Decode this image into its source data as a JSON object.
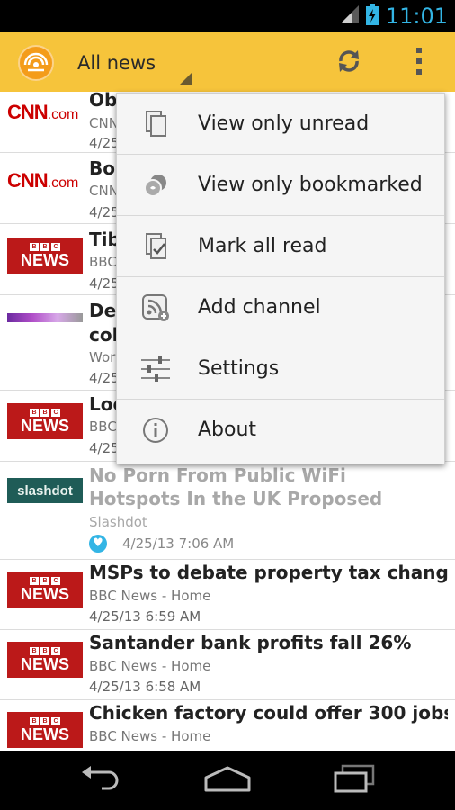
{
  "status_bar": {
    "time": "11:01",
    "icons": [
      "signal-icon",
      "battery-charging-icon"
    ]
  },
  "action_bar": {
    "logo_icon": "rss-logo-icon",
    "title": "All news",
    "refresh_icon": "refresh-icon",
    "overflow_icon": "overflow-menu-icon"
  },
  "news": [
    {
      "title": "Ob",
      "source": "CNN",
      "date": "4/25",
      "logo": "CNN",
      "read": false
    },
    {
      "title": "Bor",
      "source": "CNN",
      "date": "4/25",
      "logo": "CNN",
      "read": false
    },
    {
      "title": "Tib",
      "source": "BBC",
      "date": "4/25",
      "logo": "BBC",
      "read": false
    },
    {
      "title": "Dea",
      "title2": "col",
      "source": "Wor",
      "date": "4/25",
      "logo": "World Crunch",
      "read": false
    },
    {
      "title": "Loc",
      "source": "BBC",
      "date": "4/25",
      "logo": "BBC",
      "read": false
    },
    {
      "title": "No Porn From Public WiFi Hotspots In the UK Proposed",
      "source": "Slashdot",
      "date": "4/25/13 7:06 AM",
      "logo": "slashdot",
      "read": true,
      "bookmarked": true
    },
    {
      "title": "MSPs to debate property tax changes",
      "source": "BBC News - Home",
      "date": "4/25/13 6:59 AM",
      "logo": "BBC",
      "read": false
    },
    {
      "title": "Santander bank profits fall 26%",
      "source": "BBC News - Home",
      "date": "4/25/13 6:58 AM",
      "logo": "BBC",
      "read": false
    },
    {
      "title": "Chicken factory could offer 300 jobs",
      "source": "BBC News - Home",
      "date": "",
      "logo": "BBC",
      "read": false
    }
  ],
  "logos": {
    "cnn_main": "CNN",
    "cnn_dot": ".com",
    "bbc_letters": [
      "B",
      "B",
      "C"
    ],
    "bbc_word": "NEWS",
    "slashdot_word": "slashdot"
  },
  "overflow_menu": {
    "items": [
      {
        "label": "View only unread",
        "icon": "view-unread-icon"
      },
      {
        "label": "View only bookmarked",
        "icon": "bookmark-icon"
      },
      {
        "label": "Mark all read",
        "icon": "mark-read-icon"
      },
      {
        "label": "Add channel",
        "icon": "add-rss-icon"
      },
      {
        "label": "Settings",
        "icon": "settings-sliders-icon"
      },
      {
        "label": "About",
        "icon": "info-icon"
      }
    ]
  },
  "nav_bar": {
    "buttons": [
      "back-icon",
      "home-icon",
      "recent-apps-icon"
    ]
  },
  "colors": {
    "action_bar": "#f6c43b",
    "accent": "#33b5e5",
    "bbc_red": "#bb1919",
    "cnn_red": "#cc0000"
  }
}
